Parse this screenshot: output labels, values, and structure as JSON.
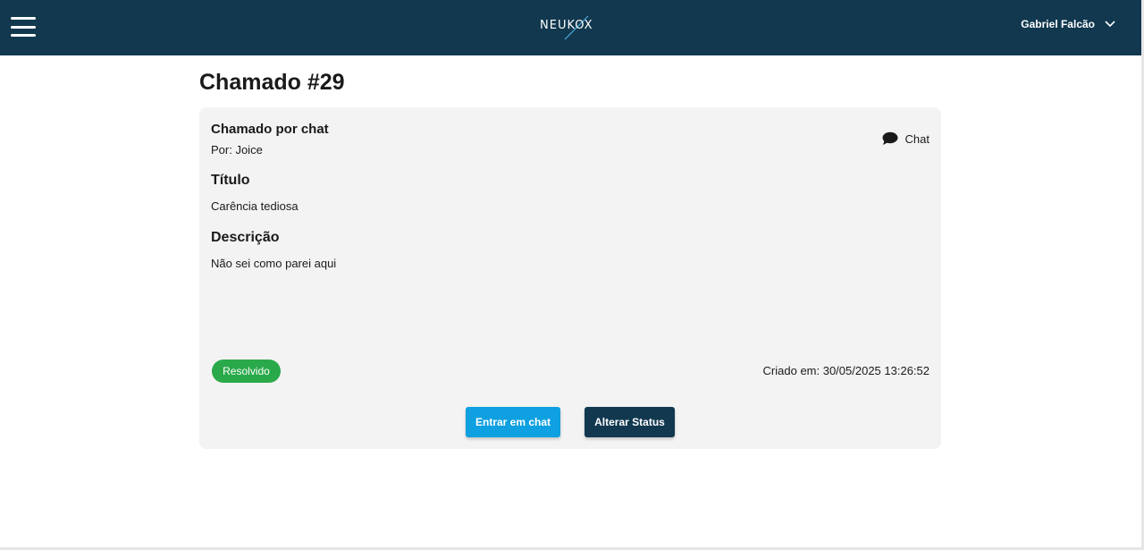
{
  "header": {
    "logo_text": "NEUKOX",
    "user_name": "Gabriel Falcão"
  },
  "ticket": {
    "title": "Chamado #29",
    "origin": "Chamado por chat",
    "author": "Por: Joice",
    "channel_label": "Chat",
    "title_label": "Título",
    "title_value": "Carência tediosa",
    "description_label": "Descrição",
    "description_value": "Não sei como parei aqui",
    "status": "Resolvido",
    "created": "Criado em: 30/05/2025 13:26:52"
  },
  "actions": {
    "enter_chat": "Entrar em chat",
    "change_status": "Alterar Status"
  },
  "colors": {
    "navbar": "#11384f",
    "status_resolved": "#2aa94a",
    "primary_button": "#0ea0e0",
    "secondary_button": "#11384f",
    "card_background": "#f3f3f3"
  }
}
